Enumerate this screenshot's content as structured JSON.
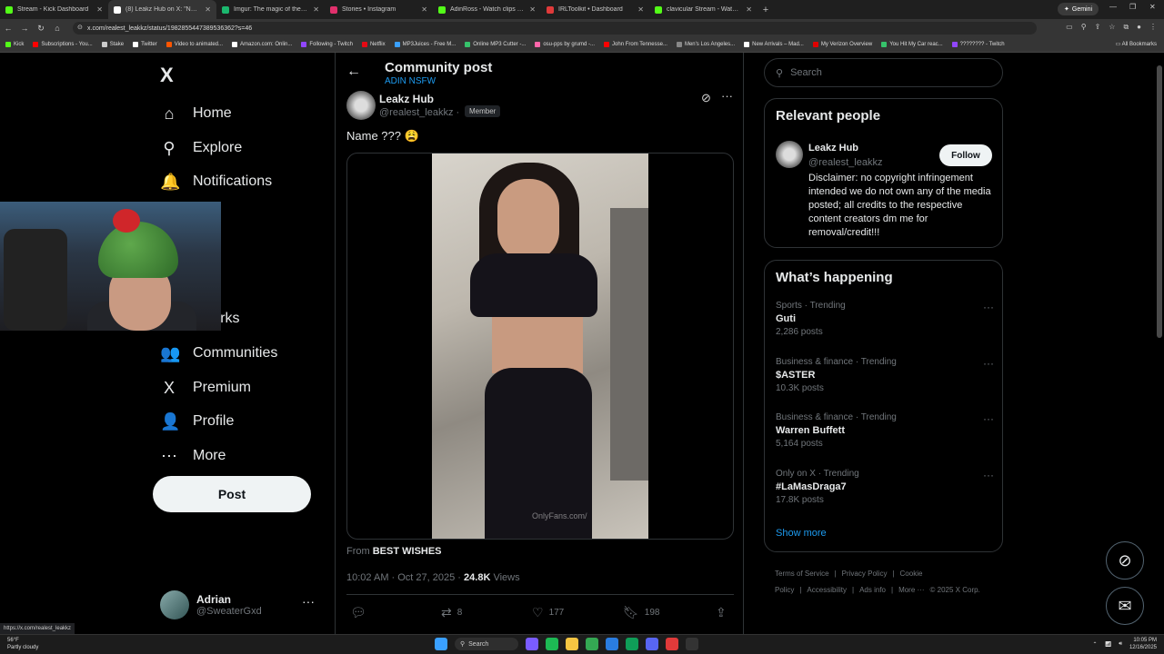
{
  "browser": {
    "tabs": [
      {
        "label": "Stream - Kick Dashboard",
        "color": "#53fc18",
        "active": false
      },
      {
        "label": "(8) Leakz Hub on X: \"Name ??\"",
        "color": "#ffffff",
        "active": true
      },
      {
        "label": "Imgur: The magic of the Internet",
        "color": "#1bb76e",
        "active": false
      },
      {
        "label": "Stories • Instagram",
        "color": "#e1306c",
        "active": false
      },
      {
        "label": "AdinRoss - Watch clips on Kick",
        "color": "#53fc18",
        "active": false
      },
      {
        "label": "IRLToolkit • Dashboard",
        "color": "#e03a3a",
        "active": false
      },
      {
        "label": "clavicular Stream - Watch Live on Kick",
        "color": "#53fc18",
        "active": false
      }
    ],
    "new_tab": "+",
    "gemini": "Gemini",
    "url": "x.com/realest_leakkz/status/1982855447389536362?s=46",
    "bookmarks": [
      {
        "label": "Kick",
        "color": "#53fc18"
      },
      {
        "label": "Subscriptions - You...",
        "color": "#ff0000"
      },
      {
        "label": "Stake",
        "color": "#cccccc"
      },
      {
        "label": "Twitter",
        "color": "#ffffff"
      },
      {
        "label": "Video to animated...",
        "color": "#ff5500"
      },
      {
        "label": "Amazon.com: Onlin...",
        "color": "#ffffff"
      },
      {
        "label": "Following - Twitch",
        "color": "#9146ff"
      },
      {
        "label": "Netflix",
        "color": "#e50914"
      },
      {
        "label": "MP3Juices - Free M...",
        "color": "#3aa0ff"
      },
      {
        "label": "Online MP3 Cutter -...",
        "color": "#36c26b"
      },
      {
        "label": "osu-pps by grumd -...",
        "color": "#ff66aa"
      },
      {
        "label": "John From Tennesse...",
        "color": "#ff0000"
      },
      {
        "label": "Men's Los Angeles...",
        "color": "#888888"
      },
      {
        "label": "New Arrivals – Mad...",
        "color": "#ffffff"
      },
      {
        "label": "My Verizon Overview",
        "color": "#e00000"
      },
      {
        "label": "You Hit My Car reac...",
        "color": "#36c26b"
      },
      {
        "label": "???????? - Twitch",
        "color": "#9146ff"
      }
    ],
    "all_bookmarks": "All Bookmarks",
    "status_url": "https://x.com/realest_leakkz"
  },
  "nav": {
    "logo": "X",
    "items": [
      {
        "label": "Home",
        "icon": "home-icon",
        "glyph": "⌂"
      },
      {
        "label": "Explore",
        "icon": "search-icon",
        "glyph": "⚲"
      },
      {
        "label": "Notifications",
        "icon": "bell-icon",
        "glyph": "🔔"
      },
      {
        "label": "kmarks",
        "icon": "bookmark-icon",
        "glyph": ""
      },
      {
        "label": "Communities",
        "icon": "communities-icon",
        "glyph": "👥"
      },
      {
        "label": "Premium",
        "icon": "x-premium-icon",
        "glyph": "X"
      },
      {
        "label": "Profile",
        "icon": "person-icon",
        "glyph": "👤"
      },
      {
        "label": "More",
        "icon": "more-circle-icon",
        "glyph": "⋯"
      }
    ],
    "post_button": "Post",
    "account": {
      "name": "Adrian",
      "handle": "@SweaterGxd",
      "more": "···"
    }
  },
  "post": {
    "header_title": "Community post",
    "community": "ADIN NSFW",
    "author": "Leakz Hub",
    "handle": "@realest_leakkz",
    "separator": "·",
    "badge": "Member",
    "text": "Name ??? 😩",
    "watermark": "OnlyFans.com/",
    "from_prefix": "From",
    "from_name": "BEST WISHES",
    "timestamp": "10:02 AM · Oct 27, 2025 ·",
    "views_count": "24.8K",
    "views_label": "Views",
    "replies": "",
    "reposts": "8",
    "likes": "177",
    "bookmarks": "198"
  },
  "sidebar": {
    "search_placeholder": "Search",
    "relevant_title": "Relevant people",
    "person": {
      "name": "Leakz Hub",
      "handle": "@realest_leakkz",
      "follow": "Follow",
      "bio": "Disclaimer: no copyright infringement intended we do not own any of the media posted; all credits to the respective content creators dm me for removal/credit!!!"
    },
    "happening_title": "What’s happening",
    "trends": [
      {
        "category": "Sports · Trending",
        "name": "Guti",
        "posts": "2,286 posts"
      },
      {
        "category": "Business & finance · Trending",
        "name": "$ASTER",
        "posts": "10.3K posts"
      },
      {
        "category": "Business & finance · Trending",
        "name": "Warren Buffett",
        "posts": "5,164 posts"
      },
      {
        "category": "Only on X · Trending",
        "name": "#LaMasDraga7",
        "posts": "17.8K posts"
      }
    ],
    "show_more": "Show more",
    "footer": [
      "Terms of Service",
      "|",
      "Privacy Policy",
      "|",
      "Cookie Policy",
      "|",
      "Accessibility",
      "|",
      "Ads info",
      "|",
      "More ···",
      "© 2025 X Corp."
    ]
  },
  "taskbar": {
    "temp": "56°F",
    "weather": "Partly cloudy",
    "search": "Search",
    "time": "10:05 PM",
    "date": "12/16/2025"
  }
}
